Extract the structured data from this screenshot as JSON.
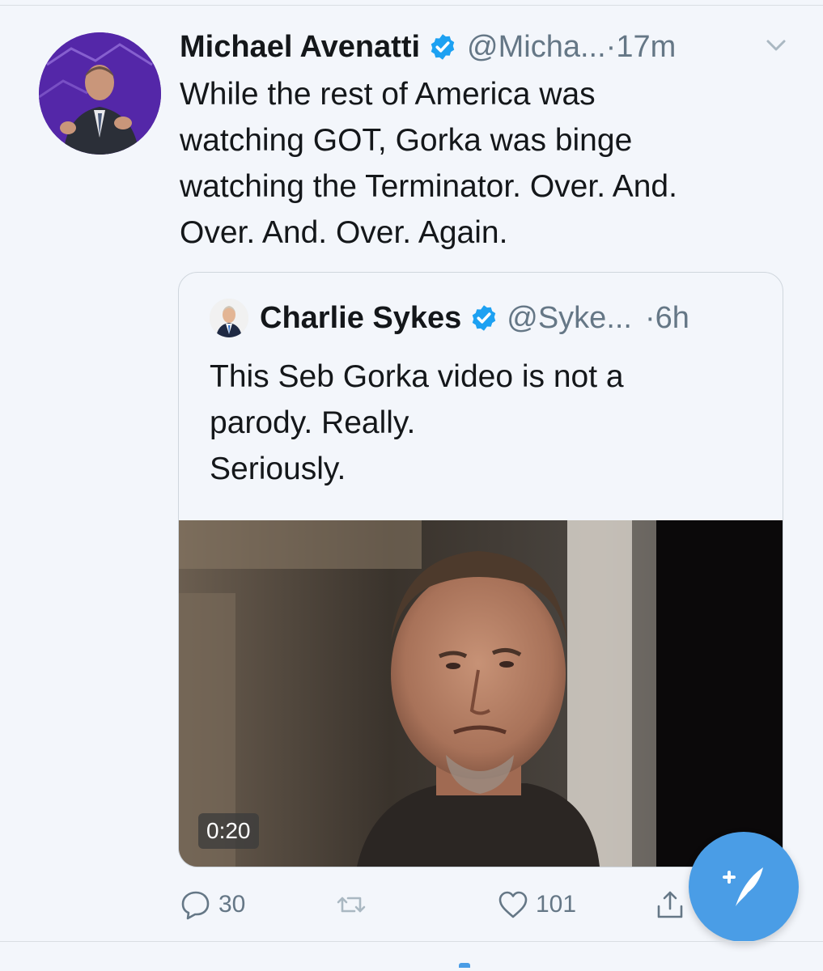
{
  "tweet": {
    "author_name": "Michael Avenatti",
    "handle": "@Micha...",
    "time": "·17m",
    "text": "While the rest of America was\nwatching GOT, Gorka was binge\nwatching the Terminator. Over. And.\nOver. And. Over. Again.",
    "verified": true,
    "avatar_icon": "avatar-photo"
  },
  "quoted_tweet": {
    "author_name": "Charlie Sykes",
    "handle": "@Syke...",
    "time": "·6h",
    "text": "This Seb Gorka video is not a\nparody. Really.\nSeriously.",
    "verified": true,
    "video_duration": "0:20"
  },
  "actions": {
    "reply_count": "30",
    "retweet_count": "",
    "like_count": "101",
    "share_label": ""
  },
  "colors": {
    "background": "#f3f6fb",
    "accent": "#4a9de6",
    "secondary_text": "#657786",
    "verified_badge": "#1da1f2"
  },
  "icons": {
    "verified": "verified-badge-icon",
    "more": "chevron-down-icon",
    "reply": "reply-icon",
    "retweet": "retweet-icon",
    "like": "heart-icon",
    "share": "share-icon",
    "compose": "compose-tweet-icon"
  }
}
